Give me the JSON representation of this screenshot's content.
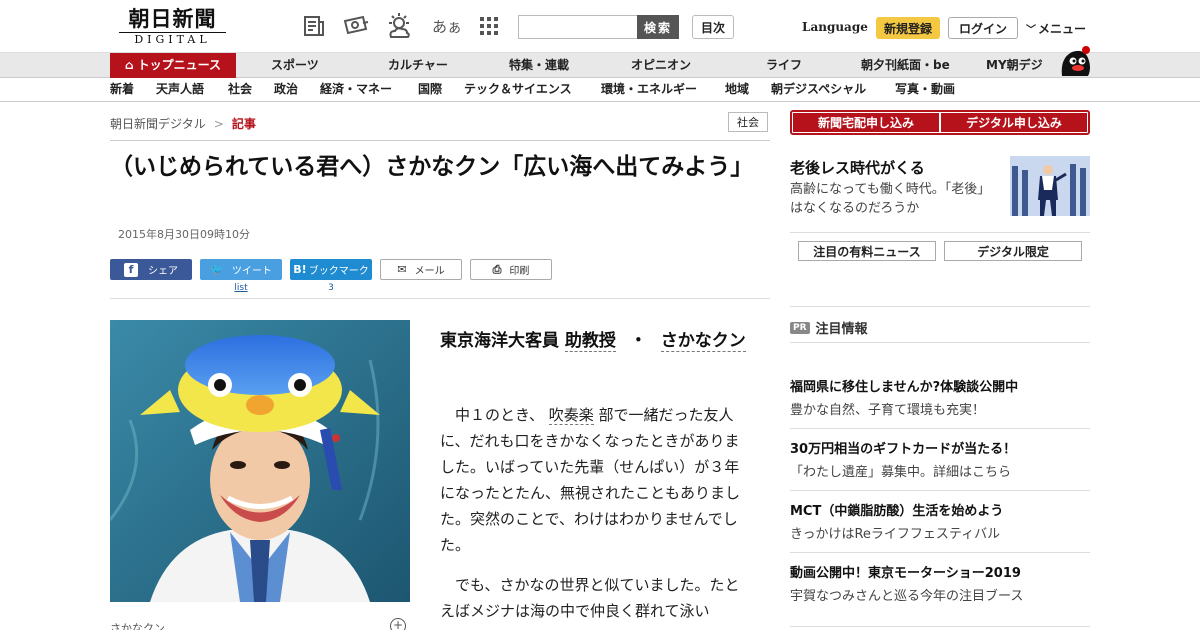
{
  "header": {
    "logo_jp": "朝日新聞",
    "logo_en": "DIGITAL",
    "search_button": "検索",
    "toc_button": "目次",
    "language": "Language",
    "register": "新規登録",
    "login": "ログイン",
    "menu": "メニュー",
    "icons": [
      "newspaper-icon",
      "camera-icon",
      "weather-icon",
      "font-size-icon",
      "grid-icon"
    ],
    "font_icon_text": "あぁ"
  },
  "nav_primary": [
    "トップニュース",
    "スポーツ",
    "カルチャー",
    "特集・連載",
    "オピニオン",
    "ライフ",
    "朝夕刊紙面・be",
    "MY朝デジ"
  ],
  "nav_secondary": [
    "新着",
    "天声人語",
    "社会",
    "政治",
    "経済・マネー",
    "国際",
    "テック＆サイエンス",
    "環境・エネルギー",
    "地域",
    "朝デジスペシャル",
    "写真・動画"
  ],
  "breadcrumb": {
    "home": "朝日新聞デジタル",
    "sep": ">",
    "current": "記事"
  },
  "category_badge": "社会",
  "article": {
    "headline": "（いじめられている君へ）さかなクン「広い海へ出てみよう」",
    "date": "2015年8月30日09時10分",
    "byline_prefix": "東京海洋大客員",
    "byline_link1": "助教授",
    "byline_sep": "・",
    "byline_link2": "さかなクン",
    "p1_indent": "中１のとき、",
    "p1_link": "吹奏楽",
    "p1_rest": "部で一緒だった友人に、だれも口をきかなくなったときがありました。いばっていた先輩（せんぱい）が３年になったとたん、無視されたこともありました。突然のことで、わけはわかりませんでした。",
    "p2": "でも、さかなの世界と似ていました。たとえばメジナは海の中で仲良く群れて泳い",
    "caption": "さかなクン"
  },
  "share": {
    "facebook": "シェア",
    "twitter": "ツイート",
    "twitter_count": "list",
    "hatena": "ブックマーク",
    "hatena_icon": "B!",
    "hatena_count": "3",
    "mail": "メール",
    "print": "印刷"
  },
  "sidebar": {
    "subscribe_paper": "新聞宅配申し込み",
    "subscribe_digital": "デジタル申し込み",
    "promo_title": "老後レス時代がくる",
    "promo_desc": "高齢になっても働く時代。「老後」はなくなるのだろうか",
    "tab_paid": "注目の有料ニュース",
    "tab_digital": "デジタル限定",
    "pr_badge": "PR",
    "pr_heading": "注目情報",
    "ads": [
      {
        "title": "福岡県に移住しませんか?体験談公開中",
        "desc": "豊かな自然、子育て環境も充実！"
      },
      {
        "title": "30万円相当のギフトカードが当たる！",
        "desc": "「わたし遺産」募集中。詳細はこちら"
      },
      {
        "title": "MCT（中鎖脂肪酸）生活を始めよう",
        "desc": "きっかけはReライフフェスティバル"
      },
      {
        "title": "動画公開中！東京モーターショー2019",
        "desc": "宇賀なつみさんと巡る今年の注目ブース"
      }
    ]
  },
  "colors": {
    "brand_red": "#b5121b",
    "register_yellow": "#f5c842",
    "facebook": "#3b5998",
    "twitter": "#4a9fe0",
    "hatena": "#1f8bd1"
  }
}
